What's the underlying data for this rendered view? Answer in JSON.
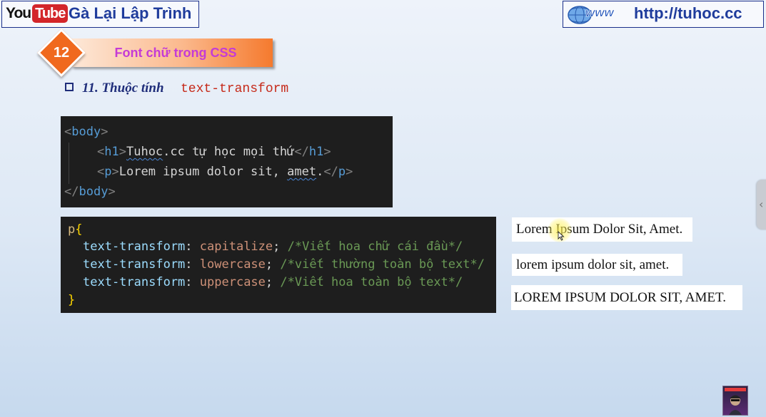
{
  "header": {
    "youtube_logo": {
      "you": "You",
      "tube": "Tube"
    },
    "channel_name": "Gà Lại Lập Trình",
    "site_url": "http://tuhoc.cc",
    "globe_icon": "www-globe-icon"
  },
  "lesson": {
    "number": "12",
    "title": "Font chữ trong CSS"
  },
  "section": {
    "heading": "11. Thuộc tính",
    "property": "text-transform"
  },
  "html_code": {
    "lines": [
      [
        "<",
        "body",
        ">"
      ],
      [
        "<",
        "h1",
        ">",
        "Tuhoc",
        ".cc tự học mọi thứ",
        "</",
        "h1",
        ">"
      ],
      [
        "<",
        "p",
        ">",
        "Lorem ipsum dolor sit, ",
        "amet",
        ".",
        "</",
        "p",
        ">"
      ],
      [
        "</",
        "body",
        ">"
      ]
    ]
  },
  "css_code": {
    "selector": "p",
    "open_brace": "{",
    "close_brace": "}",
    "rules": [
      {
        "property": "text-transform",
        "value": "capitalize",
        "comment": "/*Viết hoa chữ cái đầu*/"
      },
      {
        "property": "text-transform",
        "value": "lowercase",
        "comment": "/*viết thường toàn bộ text*/"
      },
      {
        "property": "text-transform",
        "value": "uppercase",
        "comment": "/*Viết hoa toàn bộ text*/"
      }
    ]
  },
  "outputs": [
    "Lorem Ipsum Dolor Sit, Amet.",
    "lorem ipsum dolor sit, amet.",
    "LOREM IPSUM DOLOR SIT, AMET."
  ],
  "colors": {
    "accent_orange": "#f0691e",
    "title_magenta": "#c43bd6",
    "brand_blue": "#1f3c9c",
    "property_red": "#c62a1a",
    "code_bg": "#1e1e1e"
  },
  "icons": {
    "side_tab": "chevron-left-icon",
    "avatar": "subscribe-avatar-icon",
    "cursor": "mouse-pointer-icon"
  }
}
